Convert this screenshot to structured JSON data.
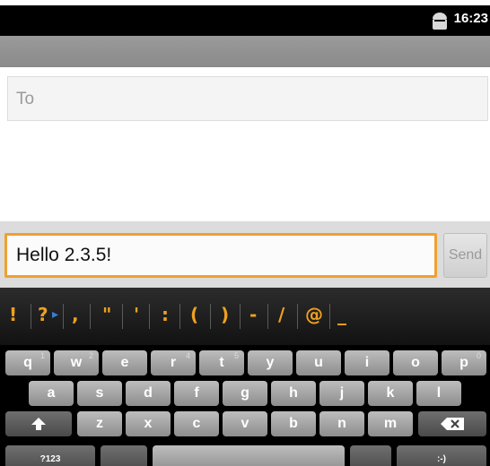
{
  "status_bar": {
    "time": "16:23",
    "icon": "android-icon"
  },
  "to_field": {
    "placeholder": "To"
  },
  "compose": {
    "message": "Hello 2.3.5!",
    "send_label": "Send"
  },
  "keyboard": {
    "suggestions": [
      "!",
      "?",
      ",",
      "\"",
      "'",
      ":",
      "(",
      ")",
      "-",
      "/",
      "@",
      "_"
    ],
    "row1": [
      {
        "label": "q",
        "hint": "1"
      },
      {
        "label": "w",
        "hint": "2"
      },
      {
        "label": "e",
        "hint": ""
      },
      {
        "label": "r",
        "hint": "4"
      },
      {
        "label": "t",
        "hint": "5"
      },
      {
        "label": "y",
        "hint": ""
      },
      {
        "label": "u",
        "hint": ""
      },
      {
        "label": "i",
        "hint": ""
      },
      {
        "label": "o",
        "hint": ""
      },
      {
        "label": "p",
        "hint": "0"
      }
    ],
    "row2": [
      "a",
      "s",
      "d",
      "f",
      "g",
      "h",
      "j",
      "k",
      "l"
    ],
    "row3": [
      "z",
      "x",
      "c",
      "v",
      "b",
      "n",
      "m"
    ],
    "shift_icon": "shift-arrow-icon",
    "delete_icon": "backspace-icon",
    "symbols_label": "?123",
    "enter_label": ":-)"
  },
  "colors": {
    "accent": "#f0a030",
    "suggestion": "#f0a020"
  }
}
